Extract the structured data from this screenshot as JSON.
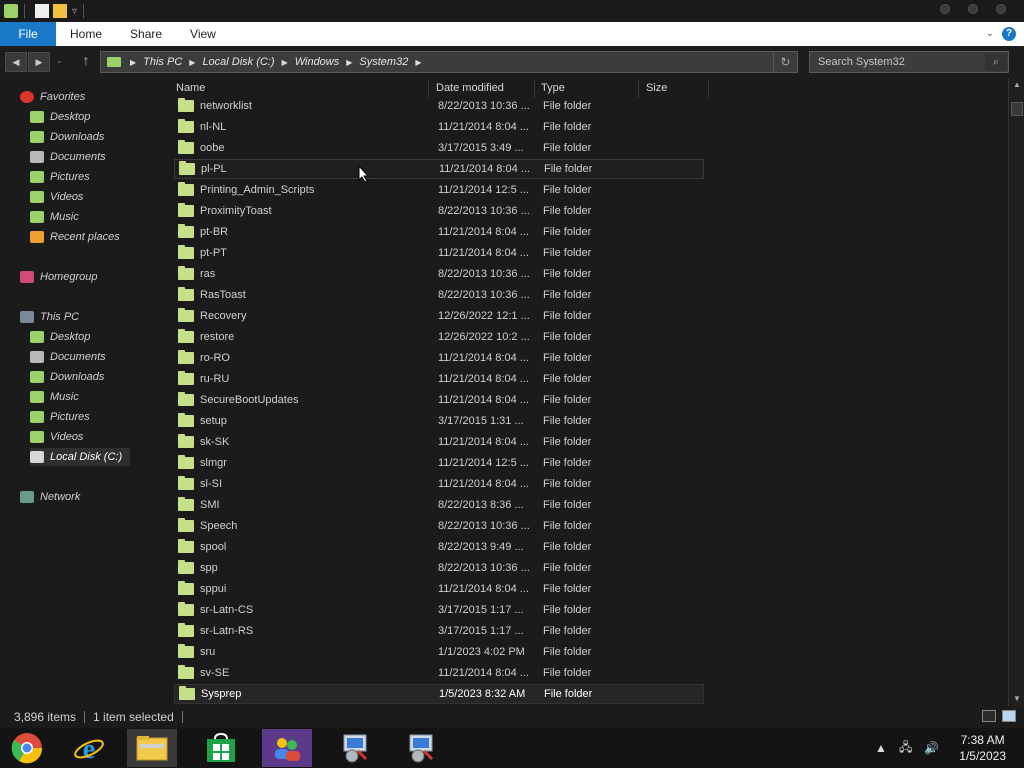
{
  "titlebar": {
    "quick_access_chevron": "▿"
  },
  "ribbon": {
    "tabs": [
      "File",
      "Home",
      "Share",
      "View"
    ],
    "help": "?"
  },
  "address": {
    "breadcrumb": [
      "This PC",
      "Local Disk (C:)",
      "Windows",
      "System32"
    ]
  },
  "search": {
    "placeholder": "Search System32"
  },
  "sidebar": {
    "favorites_label": "Favorites",
    "favorites": [
      {
        "label": "Desktop",
        "icon": "desktop-icon",
        "color": "#9bd26a"
      },
      {
        "label": "Downloads",
        "icon": "downloads-icon",
        "color": "#9bd26a"
      },
      {
        "label": "Documents",
        "icon": "documents-icon",
        "color": "#b8b8b8"
      },
      {
        "label": "Pictures",
        "icon": "pictures-icon",
        "color": "#9bd26a"
      },
      {
        "label": "Videos",
        "icon": "videos-icon",
        "color": "#9bd26a"
      },
      {
        "label": "Music",
        "icon": "music-icon",
        "color": "#9bd26a"
      },
      {
        "label": "Recent places",
        "icon": "recent-places-icon",
        "color": "#f0a030"
      }
    ],
    "homegroup_label": "Homegroup",
    "thispc_label": "This PC",
    "thispc": [
      {
        "label": "Desktop",
        "icon": "desktop-icon",
        "color": "#9bd26a"
      },
      {
        "label": "Documents",
        "icon": "documents-icon",
        "color": "#b8b8b8"
      },
      {
        "label": "Downloads",
        "icon": "downloads-icon",
        "color": "#9bd26a"
      },
      {
        "label": "Music",
        "icon": "music-icon",
        "color": "#9bd26a"
      },
      {
        "label": "Pictures",
        "icon": "pictures-icon",
        "color": "#9bd26a"
      },
      {
        "label": "Videos",
        "icon": "videos-icon",
        "color": "#9bd26a"
      },
      {
        "label": "Local Disk (C:)",
        "icon": "drive-icon",
        "color": "#d8d8d8"
      }
    ],
    "network_label": "Network"
  },
  "columns": {
    "name": "Name",
    "date": "Date modified",
    "type": "Type",
    "size": "Size"
  },
  "files": [
    {
      "name": "networklist",
      "date": "8/22/2013 10:36 ...",
      "type": "File folder"
    },
    {
      "name": "nl-NL",
      "date": "11/21/2014 8:04 ...",
      "type": "File folder"
    },
    {
      "name": "oobe",
      "date": "3/17/2015 3:49 ...",
      "type": "File folder"
    },
    {
      "name": "pl-PL",
      "date": "11/21/2014 8:04 ...",
      "type": "File folder"
    },
    {
      "name": "Printing_Admin_Scripts",
      "date": "11/21/2014 12:5 ...",
      "type": "File folder"
    },
    {
      "name": "ProximityToast",
      "date": "8/22/2013 10:36 ...",
      "type": "File folder"
    },
    {
      "name": "pt-BR",
      "date": "11/21/2014 8:04 ...",
      "type": "File folder"
    },
    {
      "name": "pt-PT",
      "date": "11/21/2014 8:04 ...",
      "type": "File folder"
    },
    {
      "name": "ras",
      "date": "8/22/2013 10:36 ...",
      "type": "File folder"
    },
    {
      "name": "RasToast",
      "date": "8/22/2013 10:36 ...",
      "type": "File folder"
    },
    {
      "name": "Recovery",
      "date": "12/26/2022 12:1 ...",
      "type": "File folder"
    },
    {
      "name": "restore",
      "date": "12/26/2022 10:2 ...",
      "type": "File folder"
    },
    {
      "name": "ro-RO",
      "date": "11/21/2014 8:04 ...",
      "type": "File folder"
    },
    {
      "name": "ru-RU",
      "date": "11/21/2014 8:04 ...",
      "type": "File folder"
    },
    {
      "name": "SecureBootUpdates",
      "date": "11/21/2014 8:04 ...",
      "type": "File folder"
    },
    {
      "name": "setup",
      "date": "3/17/2015 1:31 ...",
      "type": "File folder"
    },
    {
      "name": "sk-SK",
      "date": "11/21/2014 8:04 ...",
      "type": "File folder"
    },
    {
      "name": "slmgr",
      "date": "11/21/2014 12:5 ...",
      "type": "File folder"
    },
    {
      "name": "sl-SI",
      "date": "11/21/2014 8:04 ...",
      "type": "File folder"
    },
    {
      "name": "SMI",
      "date": "8/22/2013 8:36 ...",
      "type": "File folder"
    },
    {
      "name": "Speech",
      "date": "8/22/2013 10:36 ...",
      "type": "File folder"
    },
    {
      "name": "spool",
      "date": "8/22/2013 9:49 ...",
      "type": "File folder"
    },
    {
      "name": "spp",
      "date": "8/22/2013 10:36 ...",
      "type": "File folder"
    },
    {
      "name": "sppui",
      "date": "11/21/2014 8:04 ...",
      "type": "File folder"
    },
    {
      "name": "sr-Latn-CS",
      "date": "3/17/2015 1:17 ...",
      "type": "File folder"
    },
    {
      "name": "sr-Latn-RS",
      "date": "3/17/2015 1:17 ...",
      "type": "File folder"
    },
    {
      "name": "sru",
      "date": "1/1/2023 4:02 PM",
      "type": "File folder"
    },
    {
      "name": "sv-SE",
      "date": "11/21/2014 8:04 ...",
      "type": "File folder"
    },
    {
      "name": "Sysprep",
      "date": "1/5/2023 8:32 AM",
      "type": "File folder"
    }
  ],
  "status": {
    "item_count": "3,896 items",
    "selected": "1 item selected"
  },
  "taskbar": {
    "apps": [
      "chrome-icon",
      "internet-explorer-icon",
      "file-explorer-icon",
      "store-icon",
      "people-icon",
      "installer-icon",
      "installer-icon"
    ],
    "time": "7:38 AM",
    "date": "1/5/2023"
  }
}
